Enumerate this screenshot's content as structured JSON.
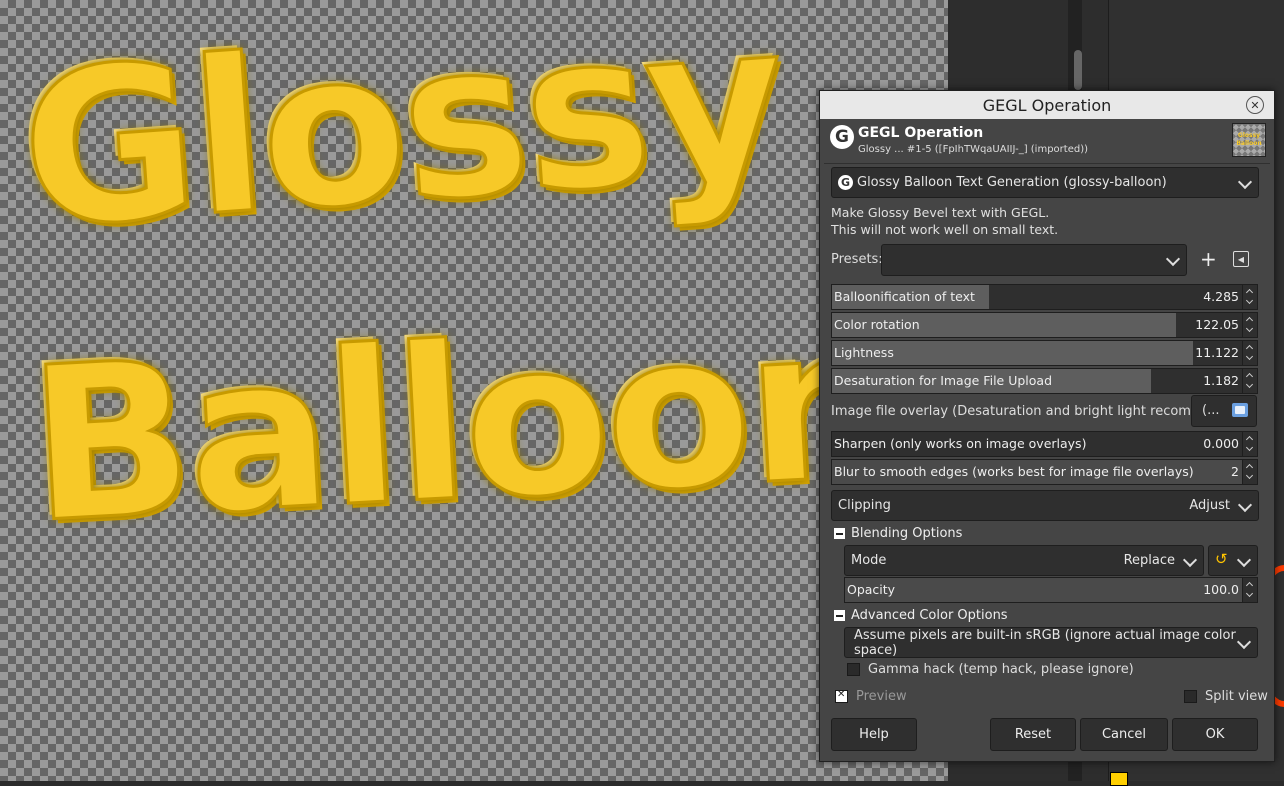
{
  "canvas": {
    "text_line1": "Glossy",
    "text_line2": "Balloon"
  },
  "dialog": {
    "window_title": "GEGL Operation",
    "close_symbol": "✕",
    "header_title": "GEGL Operation",
    "header_subtitle": "Glossy ... #1-5 ([FpIhTWqaUAIIJ-_] (imported))",
    "thumbnail_text": "Glossy Balloon",
    "operation": "Glossy Balloon Text Generation (glossy-balloon)",
    "description_line1": "Make Glossy Bevel text with GEGL.",
    "description_line2": "This will not work well on small text.",
    "presets_label": "Presets:",
    "presets_value": "",
    "presets_add": "+",
    "presets_menu": "◀",
    "params": [
      {
        "label": "Balloonification of text",
        "value": "4.285",
        "fill": 0.37
      },
      {
        "label": "Color rotation",
        "value": "122.05",
        "fill": 0.81
      },
      {
        "label": "Lightness",
        "value": "11.122",
        "fill": 0.85
      },
      {
        "label": "Desaturation for Image File Upload",
        "value": "1.182",
        "fill": 0.75
      }
    ],
    "overlay_label": "Image file overlay (Desaturation and bright light recommended)",
    "overlay_button": "(...",
    "sharpen": {
      "label": "Sharpen (only works on image overlays)",
      "value": "0.000"
    },
    "blur": {
      "label": "Blur to smooth edges (works best for image file overlays)",
      "value": "2"
    },
    "clipping": {
      "label": "Clipping",
      "value": "Adjust"
    },
    "blending_header": "Blending Options",
    "mode": {
      "label": "Mode",
      "value": "Replace"
    },
    "mode_reset_symbol": "↺",
    "opacity": {
      "label": "Opacity",
      "value": "100.0"
    },
    "advanced_header": "Advanced Color Options",
    "color_space": "Assume pixels are built-in sRGB (ignore actual image color space)",
    "gamma_hack": "Gamma hack (temp hack, please ignore)",
    "preview": "Preview",
    "split_view": "Split view",
    "buttons": {
      "help": "Help",
      "reset": "Reset",
      "cancel": "Cancel",
      "ok": "OK"
    }
  },
  "colors": {
    "text_gold": "#f7c928",
    "foreground_color": "#ffcf00",
    "accent_reset": "#ffc400"
  },
  "icons": [
    "gegl-logo-icon",
    "close-icon",
    "chevron-down-icon",
    "add-icon",
    "menu-icon",
    "folder-icon",
    "reset-icon",
    "minus-icon",
    "checkbox-icon",
    "spin-arrows-icon"
  ]
}
